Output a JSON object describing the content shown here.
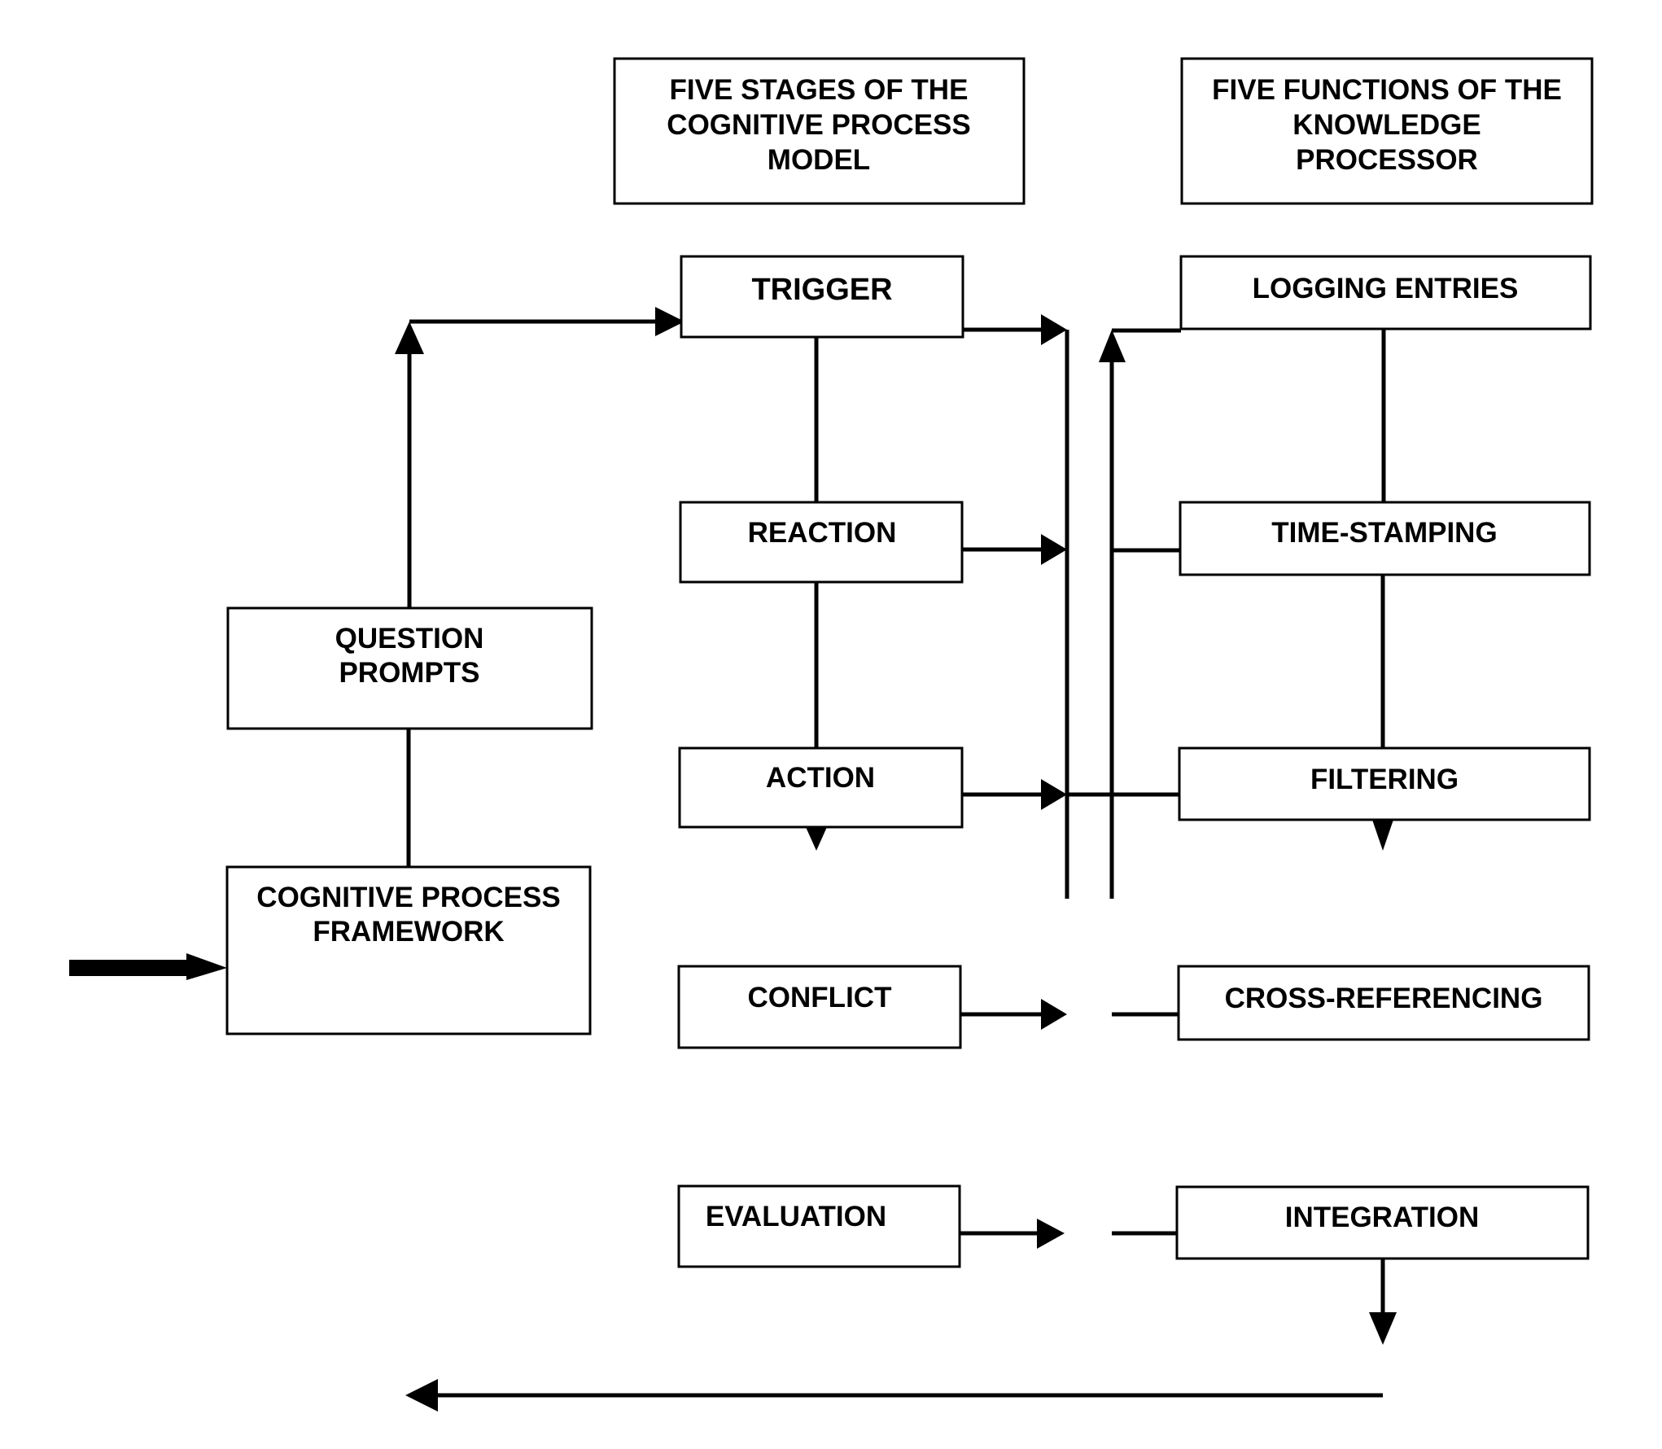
{
  "diagram": {
    "headers": {
      "cognitive_model": [
        "FIVE STAGES OF THE",
        "COGNITIVE PROCESS",
        "MODEL"
      ],
      "knowledge_processor": [
        "FIVE FUNCTIONS OF THE",
        "KNOWLEDGE",
        "PROCESSOR"
      ]
    },
    "framework": {
      "question_prompts": [
        "QUESTION",
        "PROMPTS"
      ],
      "cognitive_process_framework": [
        "COGNITIVE PROCESS",
        "FRAMEWORK"
      ]
    },
    "stages": [
      {
        "label": "TRIGGER"
      },
      {
        "label": "REACTION"
      },
      {
        "label": "ACTION"
      },
      {
        "label": "CONFLICT"
      },
      {
        "label": "EVALUATION"
      }
    ],
    "functions": [
      {
        "label": "LOGGING ENTRIES"
      },
      {
        "label": "TIME-STAMPING"
      },
      {
        "label": "FILTERING"
      },
      {
        "label": "CROSS-REFERENCING"
      },
      {
        "label": "INTEGRATION"
      }
    ],
    "colors": {
      "line": "#000000",
      "background": "#ffffff"
    }
  }
}
